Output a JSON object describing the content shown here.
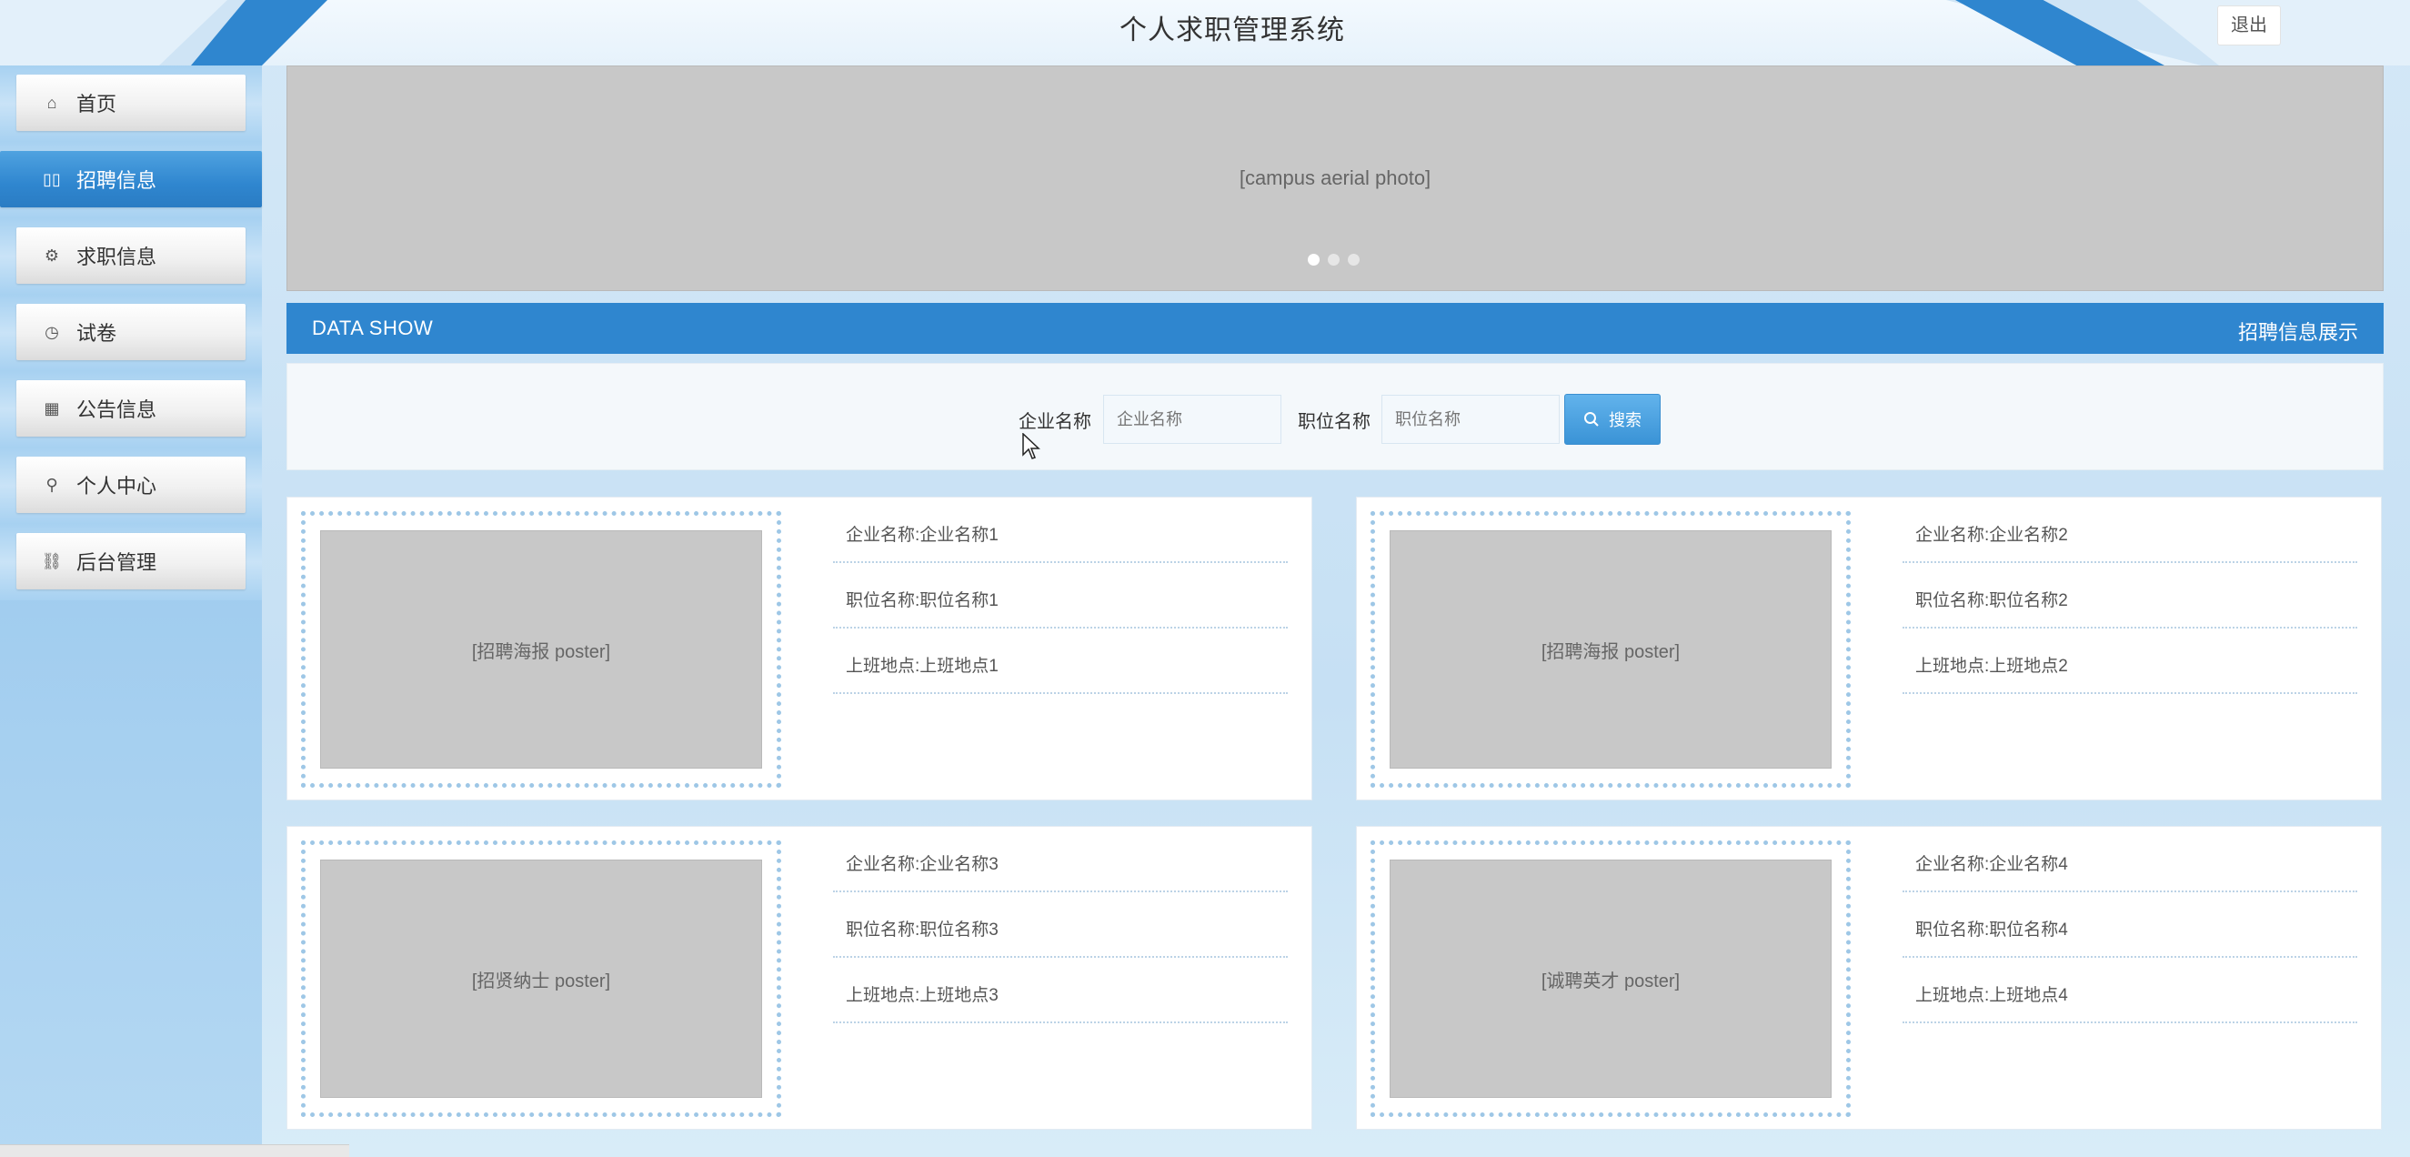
{
  "header": {
    "title": "个人求职管理系统",
    "logout_label": "退出"
  },
  "sidebar": {
    "items": [
      {
        "label": "首页",
        "icon": "home-icon",
        "glyph": "⌂",
        "active": false
      },
      {
        "label": "招聘信息",
        "icon": "grid-icon",
        "glyph": "▯▯",
        "active": true
      },
      {
        "label": "求职信息",
        "icon": "gear-icon",
        "glyph": "⚙",
        "active": false
      },
      {
        "label": "试卷",
        "icon": "clock-icon",
        "glyph": "◷",
        "active": false
      },
      {
        "label": "公告信息",
        "icon": "apps-icon",
        "glyph": "▦",
        "active": false
      },
      {
        "label": "个人中心",
        "icon": "user-icon",
        "glyph": "⚲",
        "active": false
      },
      {
        "label": "后台管理",
        "icon": "link-icon",
        "glyph": "⛓",
        "active": false
      }
    ]
  },
  "banner": {
    "image_label": "[campus aerial photo]",
    "slide_count": 3,
    "active_slide": 1
  },
  "section": {
    "left_title": "DATA SHOW",
    "right_title": "招聘信息展示"
  },
  "search": {
    "company_label": "企业名称",
    "company_placeholder": "企业名称",
    "position_label": "职位名称",
    "position_placeholder": "职位名称",
    "button_label": "搜索"
  },
  "cards": [
    {
      "image_label": "[招聘海报 poster]",
      "company": "企业名称:企业名称1",
      "position": "职位名称:职位名称1",
      "location": "上班地点:上班地点1"
    },
    {
      "image_label": "[招聘海报 poster]",
      "company": "企业名称:企业名称2",
      "position": "职位名称:职位名称2",
      "location": "上班地点:上班地点2"
    },
    {
      "image_label": "[招贤纳士 poster]",
      "company": "企业名称:企业名称3",
      "position": "职位名称:职位名称3",
      "location": "上班地点:上班地点3"
    },
    {
      "image_label": "[诚聘英才 poster]",
      "company": "企业名称:企业名称4",
      "position": "职位名称:职位名称4",
      "location": "上班地点:上班地点4"
    }
  ],
  "colors": {
    "accent": "#2f86cf",
    "sidebar_bg": "#a9d2f1",
    "page_bg": "#d4e8f7"
  }
}
